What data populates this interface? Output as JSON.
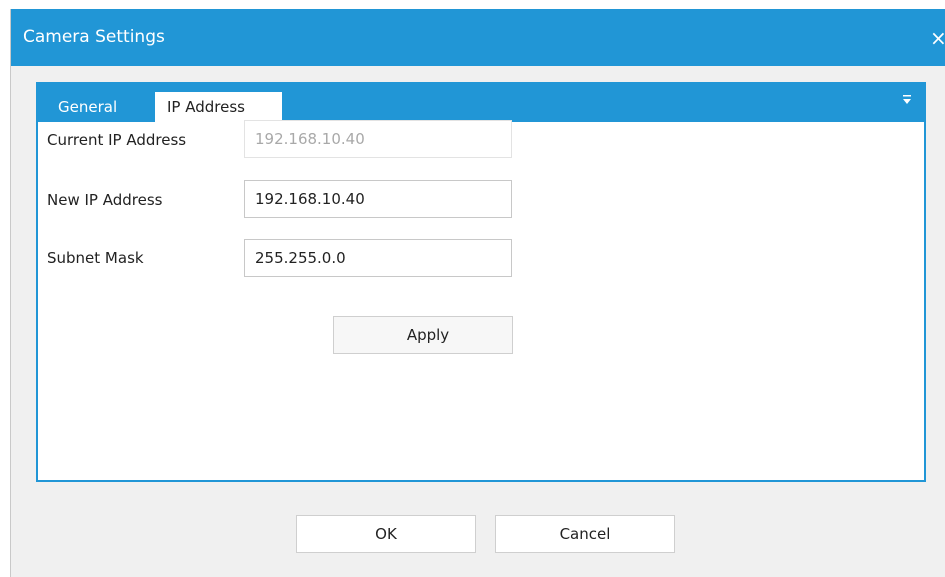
{
  "window": {
    "title": "Camera Settings",
    "close_glyph": "×"
  },
  "tabs": [
    {
      "label": "General",
      "selected": false
    },
    {
      "label": "IP Address",
      "selected": true
    }
  ],
  "tab_dropdown_icon": "dropdown-arrow-icon",
  "form": {
    "current_ip": {
      "label": "Current IP Address",
      "value": "192.168.10.40",
      "enabled": false
    },
    "new_ip": {
      "label": "New IP Address",
      "value": "192.168.10.40"
    },
    "subnet_mask": {
      "label": "Subnet Mask",
      "value": "255.255.0.0"
    },
    "apply_label": "Apply"
  },
  "buttons": {
    "ok_label": "OK",
    "cancel_label": "Cancel"
  },
  "colors": {
    "accent": "#2196d6",
    "background": "#f0f0f0",
    "disabled_text": "#a9a9a9"
  }
}
